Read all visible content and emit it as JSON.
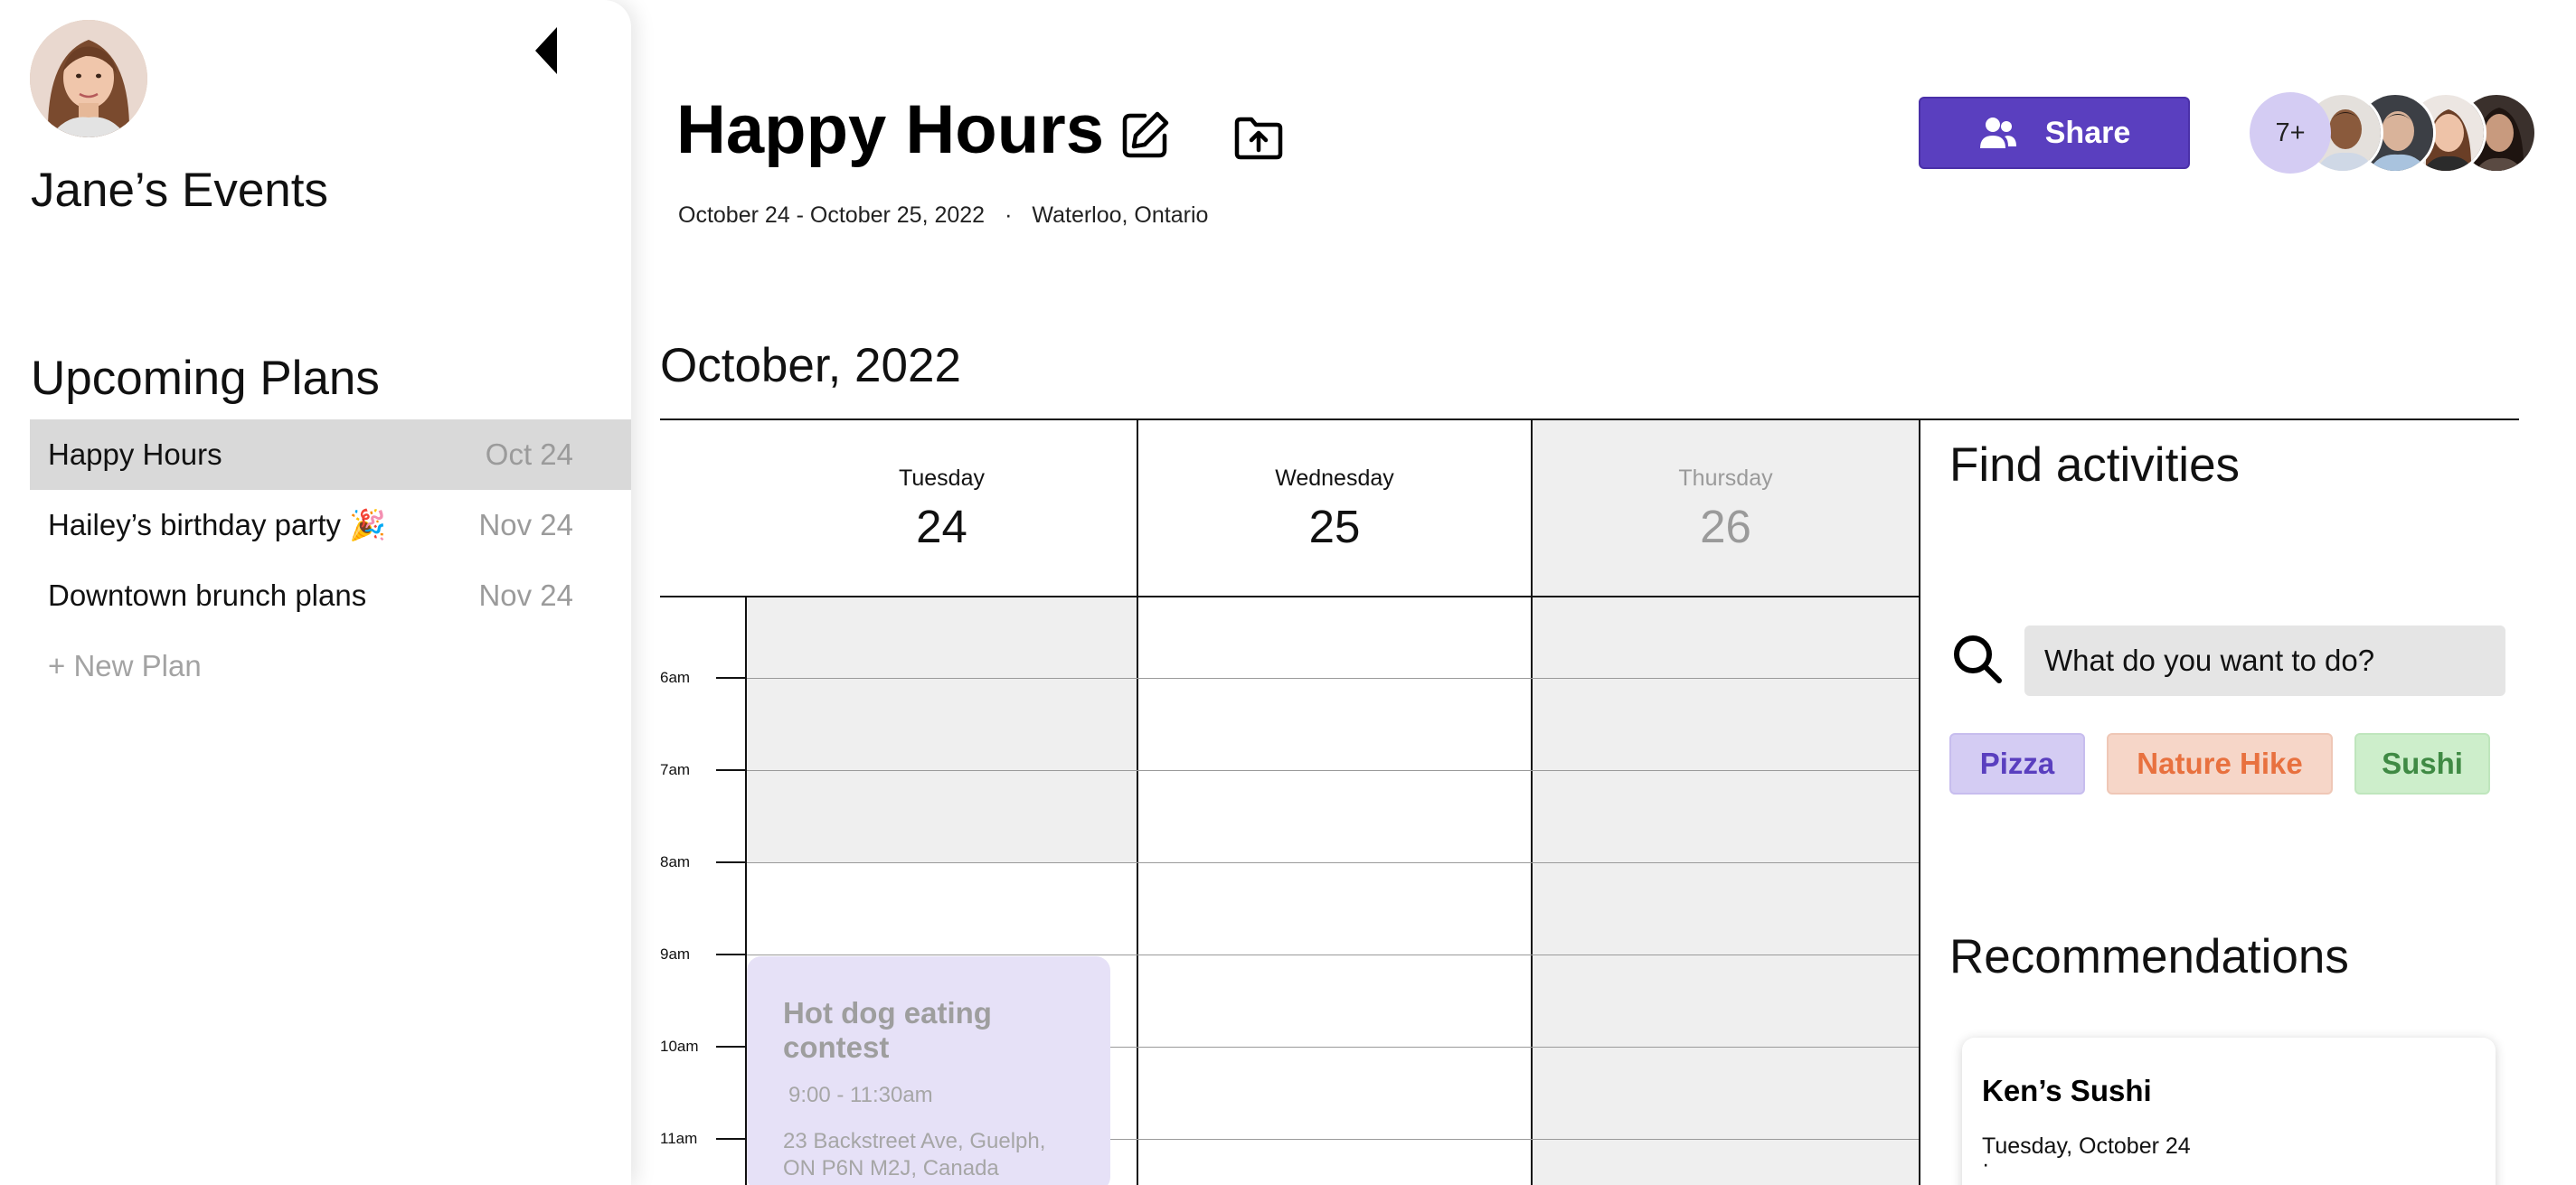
{
  "sidebar": {
    "title": "Jane’s Events",
    "section_title": "Upcoming Plans",
    "plans": [
      {
        "name": "Happy Hours",
        "date": "Oct 24",
        "active": true
      },
      {
        "name": "Hailey’s birthday party 🎉",
        "date": "Nov 24",
        "active": false
      },
      {
        "name": "Downtown brunch plans",
        "date": "Nov 24",
        "active": false
      }
    ],
    "new_plan_label": "+ New Plan"
  },
  "header": {
    "title": "Happy Hours",
    "dates": "October 24 - October 25, 2022",
    "separator": "·",
    "location": "Waterloo, Ontario",
    "share_label": "Share",
    "collaborators_more": "7+"
  },
  "calendar": {
    "month": "October, 2022",
    "days": [
      {
        "name": "Tuesday",
        "number": "24"
      },
      {
        "name": "Wednesday",
        "number": "25"
      },
      {
        "name": "Thursday",
        "number": "26"
      }
    ],
    "times": [
      "6am",
      "7am",
      "8am",
      "9am",
      "10am",
      "11am"
    ],
    "event": {
      "title": "Hot dog eating contest",
      "time": "9:00 - 11:30am",
      "address": "23 Backstreet Ave, Guelph, ON P6N M2J, Canada"
    }
  },
  "activities": {
    "title": "Find activities",
    "search_placeholder": "What do you want to do?",
    "chips": [
      {
        "label": "Pizza",
        "bg": "#d4ccf3",
        "fg": "#5a3fbf"
      },
      {
        "label": "Nature Hike",
        "bg": "#f6d6c8",
        "fg": "#e8713f"
      },
      {
        "label": "Sushi",
        "bg": "#cdeecb",
        "fg": "#3f8a44"
      }
    ]
  },
  "recommendations": {
    "title": "Recommendations",
    "card": {
      "name": "Ken’s Sushi",
      "date": "Tuesday, October 24",
      "dot": "·"
    }
  },
  "colors": {
    "accent": "#5a3fbf",
    "accent_light": "#d4ccf3",
    "event_bg": "#e6e1f7",
    "shade": "#efefef"
  }
}
